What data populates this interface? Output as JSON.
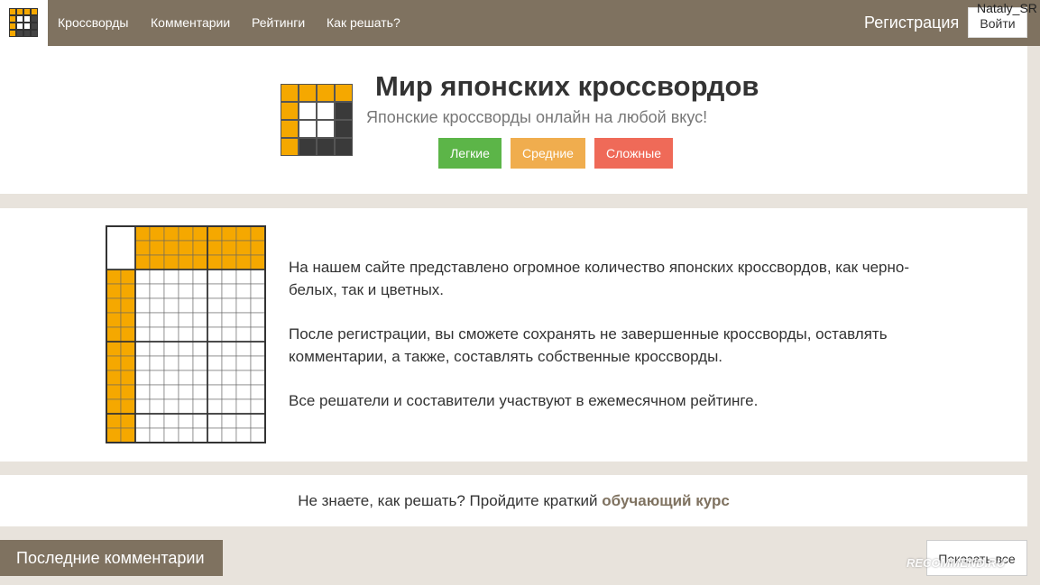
{
  "nav": {
    "items": [
      "Кроссворды",
      "Комментарии",
      "Рейтинги",
      "Как решать?"
    ],
    "register": "Регистрация",
    "login": "Войти",
    "username": "Nataly_SR"
  },
  "hero": {
    "title": "Мир японских кроссвордов",
    "subtitle": "Японские кроссворды онлайн на любой вкус!",
    "buttons": [
      "Легкие",
      "Средние",
      "Сложные"
    ]
  },
  "about": {
    "paragraphs": [
      "На нашем сайте представлено огромное количество японских кроссвордов, как черно-белых, так и цветных.",
      "После регистрации, вы сможете сохранять не завершенные кроссворды, оставлять комментарии, а также, составлять собственные кроссворды.",
      "Все решатели и составители участвуют в ежемесячном рейтинге."
    ]
  },
  "course": {
    "text": "Не знаете, как решать? Пройдите краткий",
    "link": "обучающий курс"
  },
  "comments": {
    "title": "Последние комментарии",
    "show_all": "Показать все"
  },
  "watermark": "RECOMMEND.RU",
  "colors": {
    "brand": "#7f7260",
    "orange": "#f5a800",
    "easy": "#5cb548",
    "medium": "#f0ad4e",
    "hard": "#ef6a58"
  }
}
